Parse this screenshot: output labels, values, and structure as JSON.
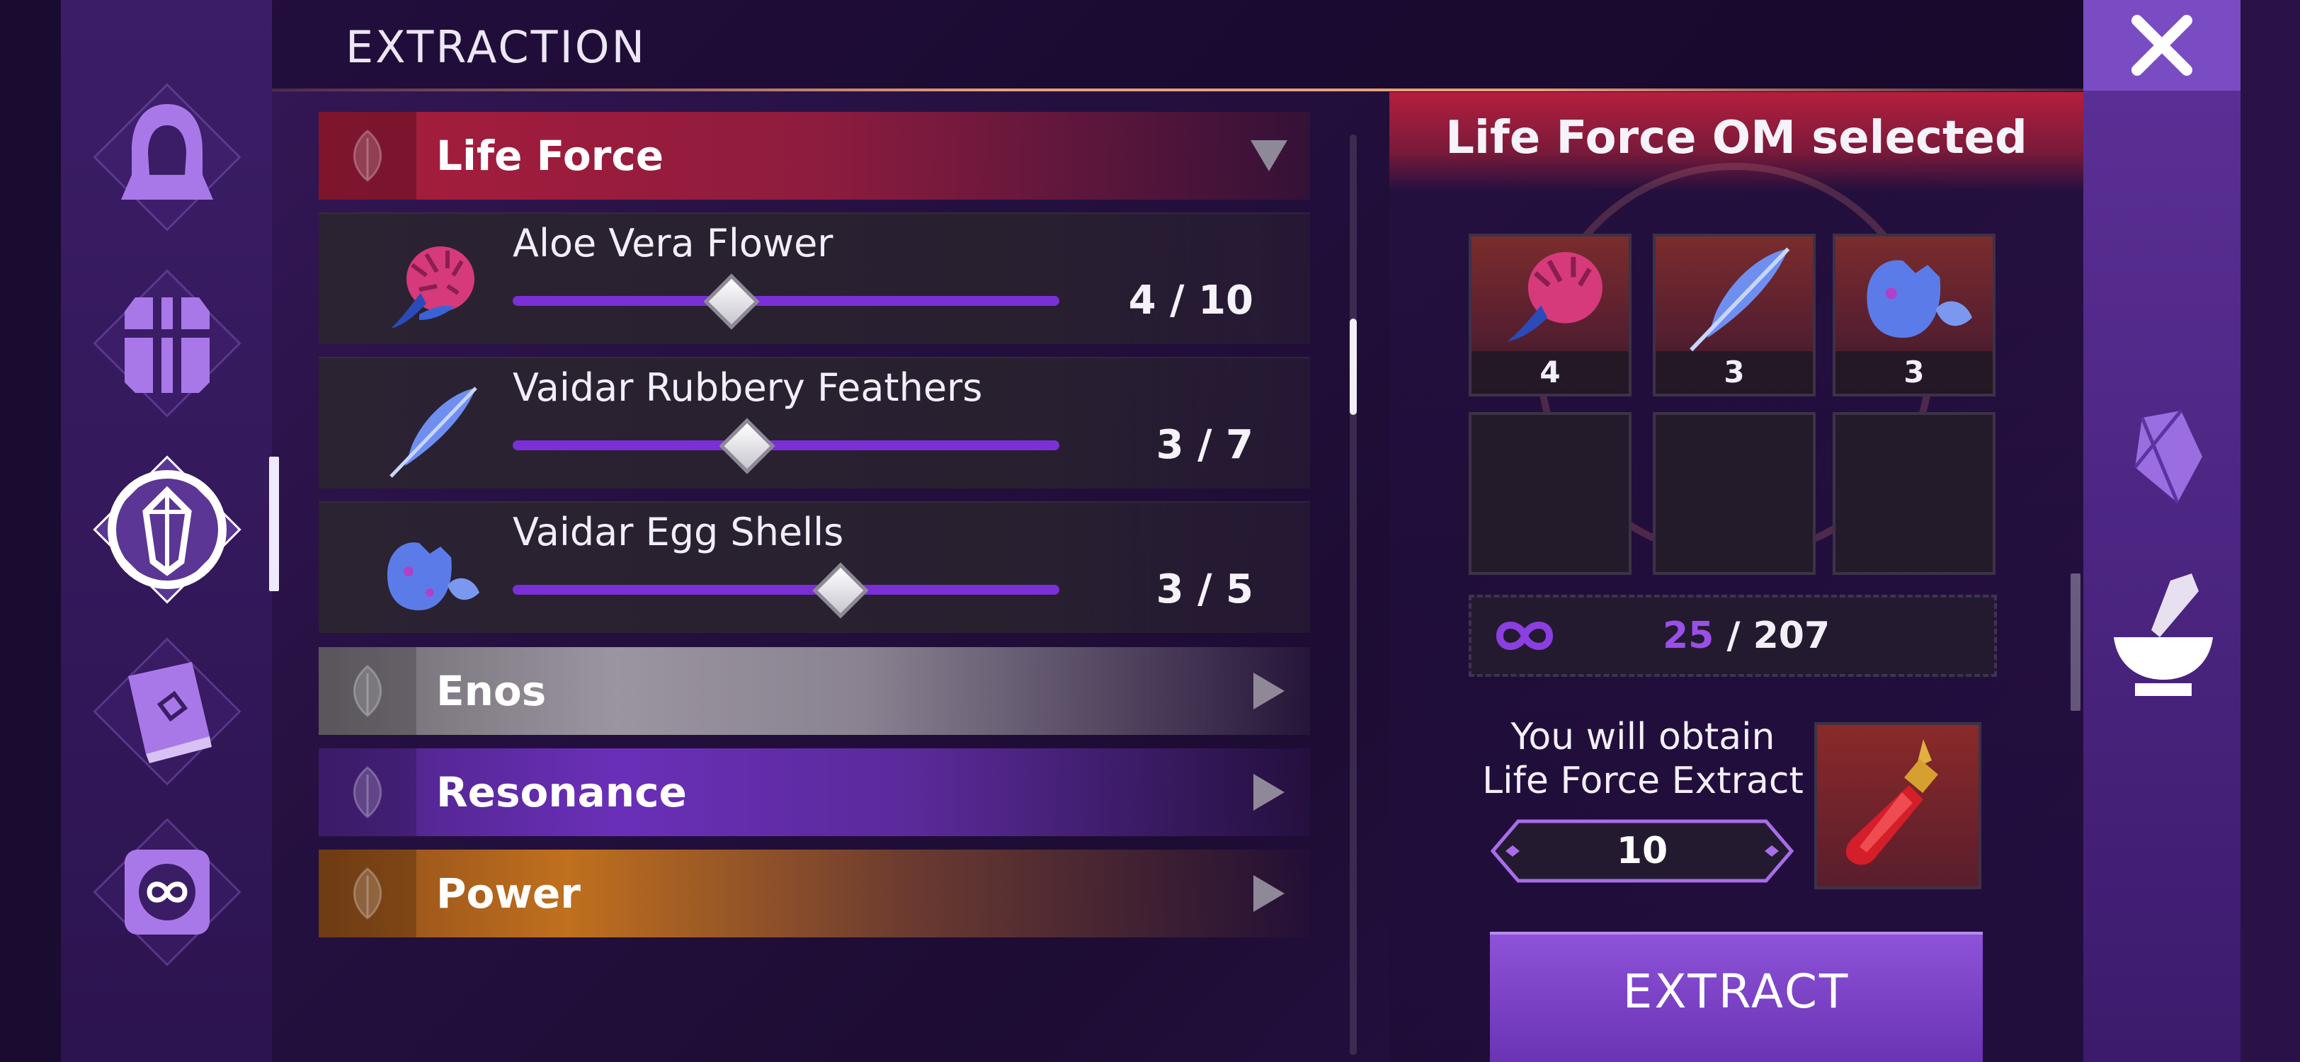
{
  "header": {
    "title": "EXTRACTION",
    "close_icon": "close-icon"
  },
  "left_nav": [
    {
      "icon": "hooded-figure-icon",
      "selected": false
    },
    {
      "icon": "chest-icon",
      "selected": false
    },
    {
      "icon": "crystal-icon",
      "selected": true
    },
    {
      "icon": "book-icon",
      "selected": false
    },
    {
      "icon": "infinity-chip-icon",
      "selected": false
    }
  ],
  "right_tabs": [
    {
      "icon": "crystal-icon",
      "selected": false
    },
    {
      "icon": "mortar-pestle-icon",
      "selected": true
    }
  ],
  "categories": [
    {
      "label": "Life Force",
      "color": "#a81d3c",
      "expanded": true,
      "arrow": "triangle-down-icon"
    },
    {
      "label": "Enos",
      "color": "#8a8290",
      "expanded": false,
      "arrow": "triangle-right-icon"
    },
    {
      "label": "Resonance",
      "color": "#6a2fb8",
      "expanded": false,
      "arrow": "triangle-right-icon"
    },
    {
      "label": "Power",
      "color": "#c0701e",
      "expanded": false,
      "arrow": "triangle-right-icon"
    }
  ],
  "ingredients": [
    {
      "name": "Aloe Vera Flower",
      "count": "4 / 10",
      "value": 4,
      "max": 10,
      "icon": "aloe-flower-icon"
    },
    {
      "name": "Vaidar Rubbery Feathers",
      "count": "3 / 7",
      "value": 3,
      "max": 7,
      "icon": "feather-icon"
    },
    {
      "name": "Vaidar Egg Shells",
      "count": "3 / 5",
      "value": 3,
      "max": 5,
      "icon": "egg-shell-icon"
    }
  ],
  "panel": {
    "selected_title": "Life Force OM selected",
    "slots": [
      {
        "icon": "aloe-flower-icon",
        "qty": "4"
      },
      {
        "icon": "feather-icon",
        "qty": "3"
      },
      {
        "icon": "egg-shell-icon",
        "qty": "3"
      },
      {
        "icon": "",
        "qty": ""
      },
      {
        "icon": "",
        "qty": ""
      },
      {
        "icon": "",
        "qty": ""
      }
    ],
    "capacity_icon": "infinity-icon",
    "capacity_current": "25",
    "capacity_sep_max": " / 207",
    "obtain_line1": "You will obtain",
    "obtain_line2": "Life Force Extract",
    "obtain_quantity": "10",
    "result_icon": "extract-vial-icon",
    "extract_label": "EXTRACT"
  },
  "colors": {
    "accent": "#7b2fd6",
    "life_force": "#a81d3c",
    "header_line": "#e6a07a"
  }
}
